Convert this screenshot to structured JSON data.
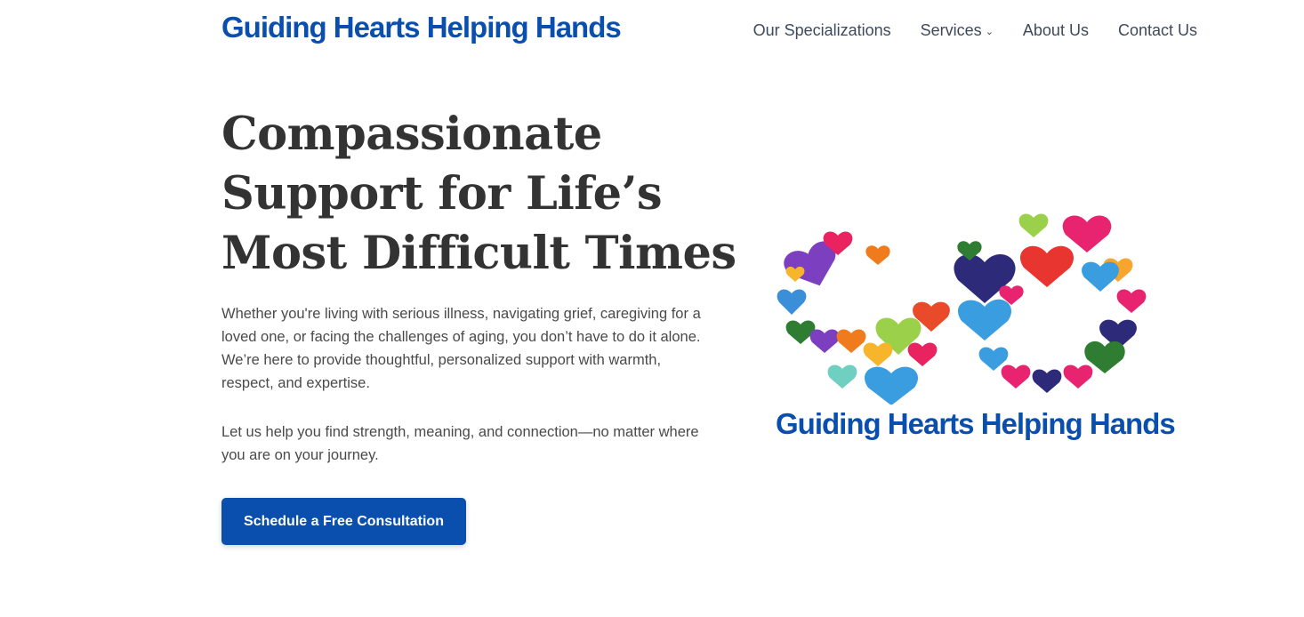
{
  "header": {
    "brand": "Guiding Hearts Helping Hands",
    "nav": [
      {
        "label": "Our Specializations"
      },
      {
        "label": "Services",
        "has_dropdown": true
      },
      {
        "label": "About Us"
      },
      {
        "label": "Contact Us"
      }
    ],
    "dropdown_icon": "chevron-down-icon"
  },
  "hero": {
    "title": "Compassionate Support for Life’s Most Difficult Times",
    "paragraph1": "Whether you're living with serious illness, navigating grief, caregiving for a loved one, or facing the challenges of aging, you don’t have to do it alone. We’re here to provide thoughtful, personalized support with warmth, respect, and expertise.",
    "paragraph2": "Let us help you find strength, meaning, and connection—no matter where you are on your journey.",
    "cta_label": "Schedule a Free Consultation"
  },
  "logo": {
    "text": "Guiding Hearts Helping Hands",
    "icon": "infinity-hearts-hands-logo"
  },
  "colors": {
    "brand_blue": "#0a4fae",
    "heading": "#333333",
    "body_text": "#4a4a4a",
    "nav_text": "#3d4a5c"
  }
}
